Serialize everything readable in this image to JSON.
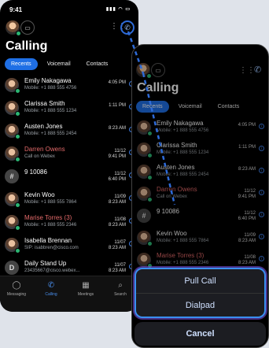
{
  "status": {
    "time": "9:41",
    "signal": "▮▮▮ ◠ ▭"
  },
  "icons": {
    "video": "▭",
    "grid": "⋮⋮",
    "phone": "✆"
  },
  "app_title": "Calling",
  "tabs": [
    "Recents",
    "Voicemail",
    "Contacts"
  ],
  "calls": [
    {
      "name": "Emily Nakagawa",
      "sub": "Mobile: +1 888 555 4756",
      "time": "4:05 PM",
      "missed": false,
      "avatar": "photo"
    },
    {
      "name": "Clarissa Smith",
      "sub": "Mobile: +1 888 555 1234",
      "time": "1:11 PM",
      "missed": false,
      "avatar": "photo"
    },
    {
      "name": "Austen Jones",
      "sub": "Mobile: +1 888 555 2454",
      "time": "8:23 AM",
      "missed": false,
      "avatar": "photo"
    },
    {
      "name": "Darren Owens",
      "sub": "Call on Webex",
      "time": "11/12\n9:41 PM",
      "missed": true,
      "avatar": "photo"
    },
    {
      "name": "9 10086",
      "sub": "",
      "time": "11/12\n6:40 PM",
      "missed": false,
      "avatar": "#"
    },
    {
      "name": "Kevin Woo",
      "sub": "Mobile: +1 888 555 7864",
      "time": "11/09\n8:23 AM",
      "missed": false,
      "avatar": "photo"
    },
    {
      "name": "Marise Torres (3)",
      "sub": "Mobile: +1 888 555 2346",
      "time": "11/08\n8:23 AM",
      "missed": true,
      "avatar": "photo"
    },
    {
      "name": "Isabella Brennan",
      "sub": "SIP: isabbren@cisco.com",
      "time": "11/07\n8:23 AM",
      "missed": false,
      "avatar": "photo"
    },
    {
      "name": "Daily Stand Up",
      "sub": "23435667@cisco.webex...",
      "time": "11/07\n8:23 AM",
      "missed": false,
      "avatar": "D"
    }
  ],
  "nav": [
    {
      "label": "Messaging",
      "icon": "◯",
      "active": false
    },
    {
      "label": "Calling",
      "icon": "✆",
      "active": true
    },
    {
      "label": "Meetings",
      "icon": "▦",
      "active": false
    },
    {
      "label": "Search",
      "icon": "⌕",
      "active": false
    }
  ],
  "sheet": {
    "pull_call": "Pull Call",
    "dialpad": "Dialpad",
    "cancel": "Cancel"
  },
  "colors": {
    "accent": "#1f6fe5",
    "missed": "#e36a6a",
    "available": "#2bb673",
    "highlight": "#3a8ff0"
  }
}
